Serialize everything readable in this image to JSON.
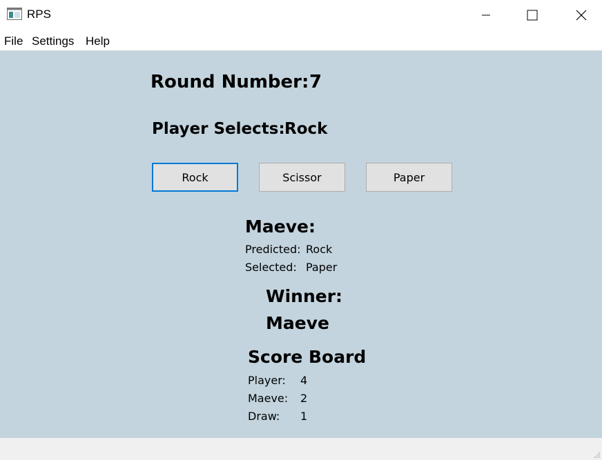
{
  "window": {
    "title": "RPS"
  },
  "menu": {
    "file": "File",
    "settings": "Settings",
    "help": "Help"
  },
  "round": {
    "label": "Round Number:",
    "value": "7"
  },
  "player_select": {
    "label": "Player Selects:",
    "value": "Rock"
  },
  "buttons": {
    "rock": "Rock",
    "scissor": "Scissor",
    "paper": "Paper"
  },
  "maeve": {
    "title": "Maeve:",
    "predicted_label": "Predicted:",
    "predicted_value": "Rock",
    "selected_label": "Selected:",
    "selected_value": "Paper"
  },
  "winner": {
    "label": "Winner:",
    "value": "Maeve"
  },
  "scoreboard": {
    "title": "Score Board",
    "rows": [
      {
        "label": "Player:",
        "value": "4"
      },
      {
        "label": "Maeve:",
        "value": "2"
      },
      {
        "label": "Draw:",
        "value": "1"
      }
    ]
  },
  "colors": {
    "background": "#c3d4de",
    "focus": "#0078d7",
    "button": "#e1e1e1"
  },
  "icons": [
    "app-icon",
    "minimize-icon",
    "maximize-icon",
    "close-icon",
    "resize-grip-icon"
  ]
}
